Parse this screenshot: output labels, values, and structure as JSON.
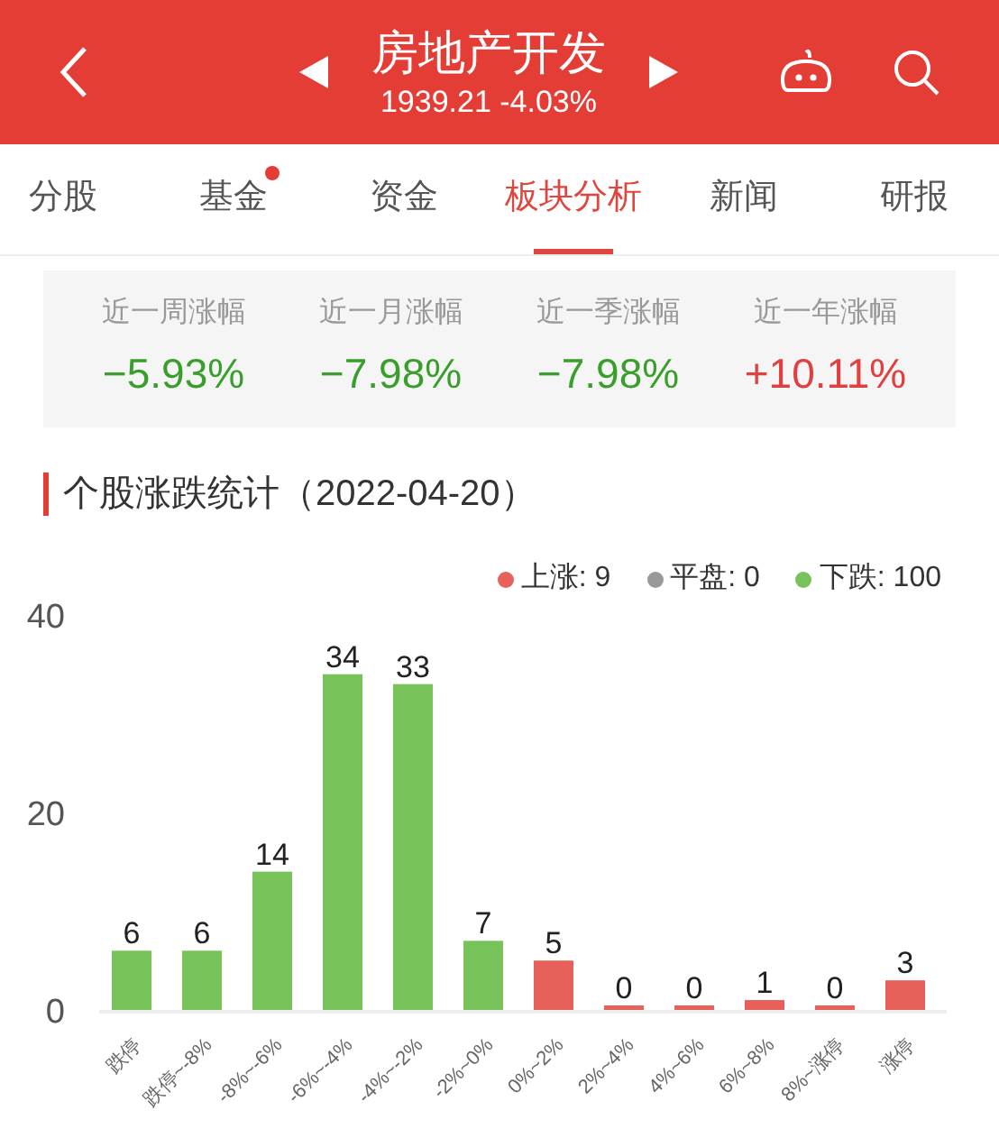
{
  "header": {
    "title": "房地产开发",
    "subtitle": "1939.21 -4.03%"
  },
  "tabs": [
    {
      "label": "分股",
      "selected": false,
      "badge": false
    },
    {
      "label": "基金",
      "selected": false,
      "badge": true
    },
    {
      "label": "资金",
      "selected": false,
      "badge": false
    },
    {
      "label": "板块分析",
      "selected": true,
      "badge": false
    },
    {
      "label": "新闻",
      "selected": false,
      "badge": false
    },
    {
      "label": "研报",
      "selected": false,
      "badge": false
    }
  ],
  "stats": [
    {
      "label": "近一周涨幅",
      "value": "−5.93%",
      "color": "#3a9e2c"
    },
    {
      "label": "近一月涨幅",
      "value": "−7.98%",
      "color": "#3a9e2c"
    },
    {
      "label": "近一季涨幅",
      "value": "−7.98%",
      "color": "#3a9e2c"
    },
    {
      "label": "近一年涨幅",
      "value": "+10.11%",
      "color": "#e04040"
    }
  ],
  "section_title": "个股涨跌统计（2022-04-20）",
  "legend_counts": [
    {
      "text": ": 9"
    },
    {
      "text": ": 0"
    },
    {
      "text": ": 100"
    }
  ],
  "chart_data": {
    "type": "bar",
    "categories": [
      "跌停",
      "跌停~-8%",
      "-8%~-6%",
      "-6%~-4%",
      "-4%~-2%",
      "-2%~0%",
      "0%~2%",
      "2%~4%",
      "4%~6%",
      "6%~8%",
      "8%~涨停",
      "涨停"
    ],
    "series": [
      {
        "name": "上涨",
        "color": "#e8605a",
        "values": [
          null,
          null,
          null,
          null,
          null,
          null,
          5,
          0,
          0,
          1,
          0,
          3
        ]
      },
      {
        "name": "平盘",
        "color": "#999999",
        "values": [
          null,
          null,
          null,
          null,
          null,
          null,
          null,
          null,
          null,
          null,
          null,
          null
        ]
      },
      {
        "name": "下跌",
        "color": "#77c35a",
        "values": [
          6,
          6,
          14,
          34,
          33,
          7,
          null,
          null,
          null,
          null,
          null,
          null
        ]
      }
    ],
    "yticks": [
      0,
      20,
      40
    ],
    "ylim": [
      0,
      40
    ],
    "stacked": true,
    "data_labels": true
  }
}
